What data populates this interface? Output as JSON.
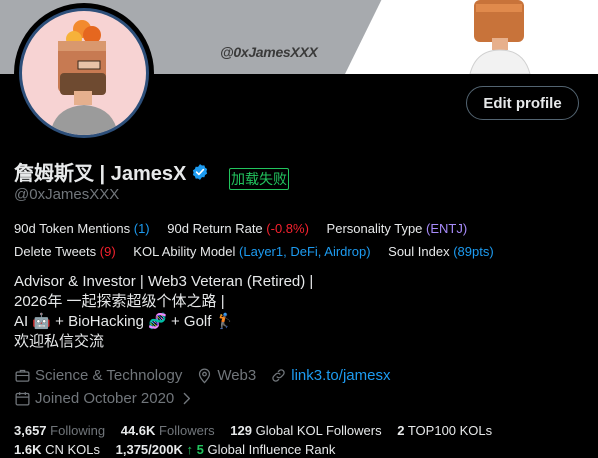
{
  "banner": {
    "handle_text": "@0xJamesXXX"
  },
  "header": {
    "edit_profile_label": "Edit profile"
  },
  "profile": {
    "display_name": "詹姆斯叉 | JamesX",
    "handle": "@0xJamesXXX",
    "load_fail_badge": "加载失败"
  },
  "metrics_row1": [
    {
      "label": "90d Token Mentions",
      "value": "(1)",
      "color": "#1d9bf0"
    },
    {
      "label": "90d Return Rate",
      "value": "(-0.8%)",
      "color": "#f4212e"
    },
    {
      "label": "Personality Type",
      "value": "(ENTJ)",
      "color": "#a78bfa"
    }
  ],
  "metrics_row2": [
    {
      "label": "Delete Tweets",
      "value": "(9)",
      "color": "#f4212e"
    },
    {
      "label": "KOL Ability Model",
      "value": "(Layer1, DeFi, Airdrop)",
      "color": "#1d9bf0"
    },
    {
      "label": "Soul Index",
      "value": "(89pts)",
      "color": "#1d9bf0"
    }
  ],
  "bio": {
    "line1": "Advisor & Investor  |  Web3 Veteran (Retired) |",
    "line2": "2026年 一起探索超级个体之路 |",
    "line3": "AI 🤖 + BioHacking 🧬 + Golf 🏌",
    "line4": "欢迎私信交流"
  },
  "meta": {
    "category": "Science & Technology",
    "location": "Web3",
    "website": "link3.to/jamesx",
    "joined": "Joined October 2020"
  },
  "stats_row1": [
    {
      "num": "3,657",
      "label": "Following"
    },
    {
      "num": "44.6K",
      "label": "Followers"
    },
    {
      "num": "129",
      "label": "Global KOL Followers"
    },
    {
      "num": "2",
      "label": "TOP100 KOLs"
    }
  ],
  "stats_row2": {
    "cn_num": "1.6K",
    "cn_label": "CN KOLs",
    "influence_num": "1,375/200K",
    "influence_delta": "↑ 5",
    "influence_label": "Global Influence Rank"
  },
  "colors": {
    "accent": "#1d9bf0",
    "red": "#f4212e",
    "purple": "#a78bfa",
    "green": "#22c55e"
  }
}
